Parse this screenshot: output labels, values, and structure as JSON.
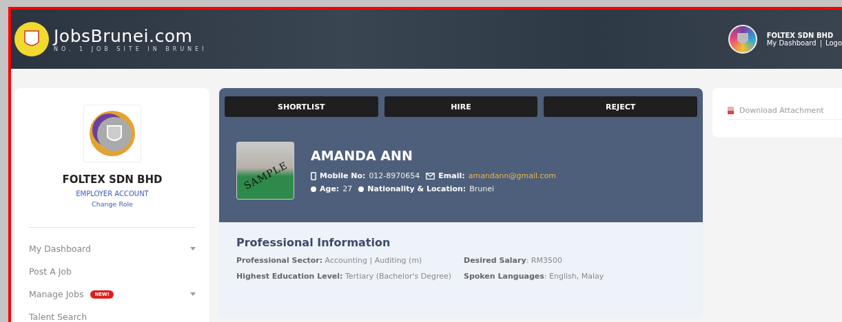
{
  "header": {
    "logo_text": "JobsBrunei.com",
    "tagline": "NO. 1 JOB SITE IN BRUNEI",
    "company": "FOLTEX SDN BHD",
    "links": [
      {
        "label": "My Dashboard"
      },
      {
        "label": "Logo"
      }
    ],
    "separator": "|"
  },
  "sidebar": {
    "company": "FOLTEX SDN BHD",
    "account_type": "EMPLOYER ACCOUNT",
    "change_role": "Change Role",
    "items": [
      {
        "label": "My Dashboard",
        "expandable": true
      },
      {
        "label": "Post A Job",
        "expandable": false
      },
      {
        "label": "Manage Jobs",
        "expandable": true,
        "badge": "NEW!"
      },
      {
        "label": "Talent Search",
        "expandable": false
      }
    ]
  },
  "actions": [
    {
      "label": "SHORTLIST"
    },
    {
      "label": "HIRE"
    },
    {
      "label": "REJECT"
    }
  ],
  "candidate": {
    "photo_stamp": "SAMPLE",
    "name": "AMANDA ANN",
    "mobile_label": "Mobile No:",
    "mobile": "012-8970654",
    "email_label": "Email:",
    "email": "amandann@gmail.com",
    "age_label": "Age:",
    "age": "27",
    "nationality_label": "Nationality & Location:",
    "nationality": "Brunei"
  },
  "professional": {
    "title": "Professional Information",
    "left": [
      "**Professional Sector:** Accounting | Auditing (m)",
      "**Highest Education Level:** Tertiary (Bachelor's Degree)"
    ],
    "right": [
      "**Desired Salary**: RM3500",
      "**Spoken Languages**: English, Malay"
    ]
  },
  "attachment": {
    "label": "Download Attachment"
  }
}
